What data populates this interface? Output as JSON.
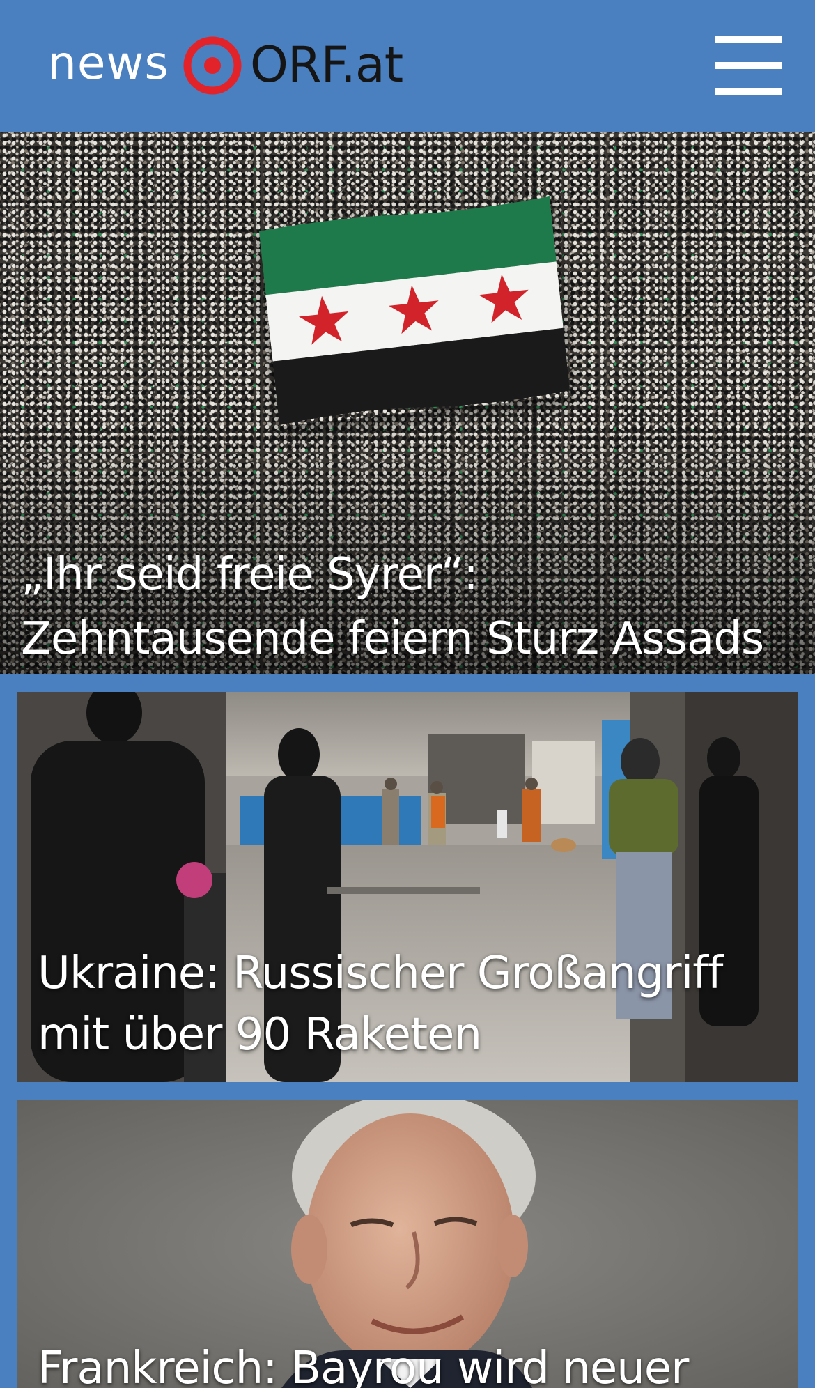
{
  "header": {
    "logo_news": "news",
    "logo_orf": "ORF.at",
    "menu_icon": "hamburger-menu-icon",
    "background_color": "#4a7fc0",
    "logo_mark_color": "#e2232a"
  },
  "articles": [
    {
      "title": "„Ihr seid freie Syrer“: Zehntausende feiern Sturz Assads",
      "image": "aerial-crowd-with-syrian-opposition-flag"
    },
    {
      "title": "Ukraine: Russischer Großangriff mit über 90 Raketen",
      "image": "people-sheltering-in-underground-parking-garage"
    },
    {
      "title": "Frankreich: Bayrou wird neuer",
      "image": "portrait-grey-haired-man-smiling"
    }
  ]
}
